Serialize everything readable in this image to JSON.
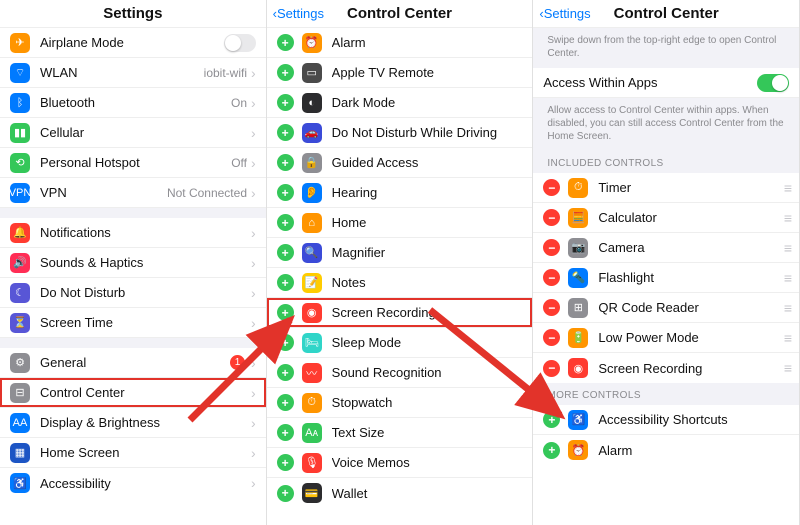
{
  "colors": {
    "blue": "#007aff",
    "green": "#34c759",
    "red": "#ff3b30",
    "gray": "#8e8e93",
    "orange": "#ff9500",
    "purple": "#5856d6",
    "teal": "#30d5c8",
    "darkgray": "#4a4a4a"
  },
  "panel1": {
    "nav": {
      "title": "Settings"
    },
    "groups": [
      {
        "rows": [
          {
            "icon": "airplane",
            "bg": "#ff9500",
            "label": "Airplane Mode",
            "toggle": false
          },
          {
            "icon": "wifi",
            "bg": "#007aff",
            "label": "WLAN",
            "value": "iobit-wifi",
            "chevron": true
          },
          {
            "icon": "bt",
            "bg": "#007aff",
            "label": "Bluetooth",
            "value": "On",
            "chevron": true
          },
          {
            "icon": "cell",
            "bg": "#34c759",
            "label": "Cellular",
            "chevron": true
          },
          {
            "icon": "hotspot",
            "bg": "#34c759",
            "label": "Personal Hotspot",
            "value": "Off",
            "chevron": true
          },
          {
            "icon": "vpn",
            "bg": "#007aff",
            "label": "VPN",
            "value": "Not Connected",
            "chevron": true
          }
        ]
      },
      {
        "rows": [
          {
            "icon": "bell",
            "bg": "#ff3b30",
            "label": "Notifications",
            "chevron": true
          },
          {
            "icon": "sound",
            "bg": "#ff2d55",
            "label": "Sounds & Haptics",
            "chevron": true
          },
          {
            "icon": "moon",
            "bg": "#5856d6",
            "label": "Do Not Disturb",
            "chevron": true
          },
          {
            "icon": "hourglass",
            "bg": "#5856d6",
            "label": "Screen Time",
            "chevron": true
          }
        ]
      },
      {
        "rows": [
          {
            "icon": "gear",
            "bg": "#8e8e93",
            "label": "General",
            "badge": "1",
            "chevron": true
          },
          {
            "icon": "switches",
            "bg": "#8e8e93",
            "label": "Control Center",
            "chevron": true,
            "highlight": true
          },
          {
            "icon": "aa",
            "bg": "#007aff",
            "label": "Display & Brightness",
            "chevron": true
          },
          {
            "icon": "grid",
            "bg": "#1d55c4",
            "label": "Home Screen",
            "chevron": true
          },
          {
            "icon": "person",
            "bg": "#007aff",
            "label": "Accessibility",
            "chevron": true
          }
        ]
      }
    ]
  },
  "panel2": {
    "nav": {
      "back": "Settings",
      "title": "Control Center"
    },
    "rows": [
      {
        "icon": "clock",
        "bg": "#ff9500",
        "label": "Alarm"
      },
      {
        "icon": "tv",
        "bg": "#4a4a4a",
        "label": "Apple TV Remote"
      },
      {
        "icon": "dark",
        "bg": "#2c2c2e",
        "label": "Dark Mode"
      },
      {
        "icon": "car",
        "bg": "#3b4bd8",
        "label": "Do Not Disturb While Driving"
      },
      {
        "icon": "lock",
        "bg": "#8e8e93",
        "label": "Guided Access"
      },
      {
        "icon": "ear",
        "bg": "#007aff",
        "label": "Hearing"
      },
      {
        "icon": "home",
        "bg": "#ff9500",
        "label": "Home"
      },
      {
        "icon": "mag",
        "bg": "#3b4bd8",
        "label": "Magnifier"
      },
      {
        "icon": "note",
        "bg": "#ffcc00",
        "label": "Notes"
      },
      {
        "icon": "rec",
        "bg": "#ff3b30",
        "label": "Screen Recording",
        "highlight": true
      },
      {
        "icon": "sleep",
        "bg": "#30d5c8",
        "label": "Sleep Mode"
      },
      {
        "icon": "wave",
        "bg": "#ff3b30",
        "label": "Sound Recognition"
      },
      {
        "icon": "timer",
        "bg": "#ff9500",
        "label": "Stopwatch"
      },
      {
        "icon": "text",
        "bg": "#34c759",
        "label": "Text Size"
      },
      {
        "icon": "voice",
        "bg": "#ff3b30",
        "label": "Voice Memos"
      },
      {
        "icon": "wallet",
        "bg": "#2c2c2e",
        "label": "Wallet"
      }
    ]
  },
  "panel3": {
    "nav": {
      "back": "Settings",
      "title": "Control Center"
    },
    "topDesc": "Swipe down from the top-right edge to open Control Center.",
    "accessRow": {
      "label": "Access Within Apps",
      "toggle": true
    },
    "accessDesc": "Allow access to Control Center within apps. When disabled, you can still access Control Center from the Home Screen.",
    "includedHeader": "INCLUDED CONTROLS",
    "included": [
      {
        "icon": "timer",
        "bg": "#ff9500",
        "label": "Timer"
      },
      {
        "icon": "calc",
        "bg": "#ff9500",
        "label": "Calculator"
      },
      {
        "icon": "cam",
        "bg": "#8e8e93",
        "label": "Camera"
      },
      {
        "icon": "flash",
        "bg": "#007aff",
        "label": "Flashlight"
      },
      {
        "icon": "qr",
        "bg": "#8e8e93",
        "label": "QR Code Reader"
      },
      {
        "icon": "battery",
        "bg": "#ff9500",
        "label": "Low Power Mode"
      },
      {
        "icon": "rec",
        "bg": "#ff3b30",
        "label": "Screen Recording"
      }
    ],
    "moreHeader": "MORE CONTROLS",
    "more": [
      {
        "icon": "access",
        "bg": "#007aff",
        "label": "Accessibility Shortcuts"
      },
      {
        "icon": "clock",
        "bg": "#ff9500",
        "label": "Alarm"
      }
    ]
  }
}
